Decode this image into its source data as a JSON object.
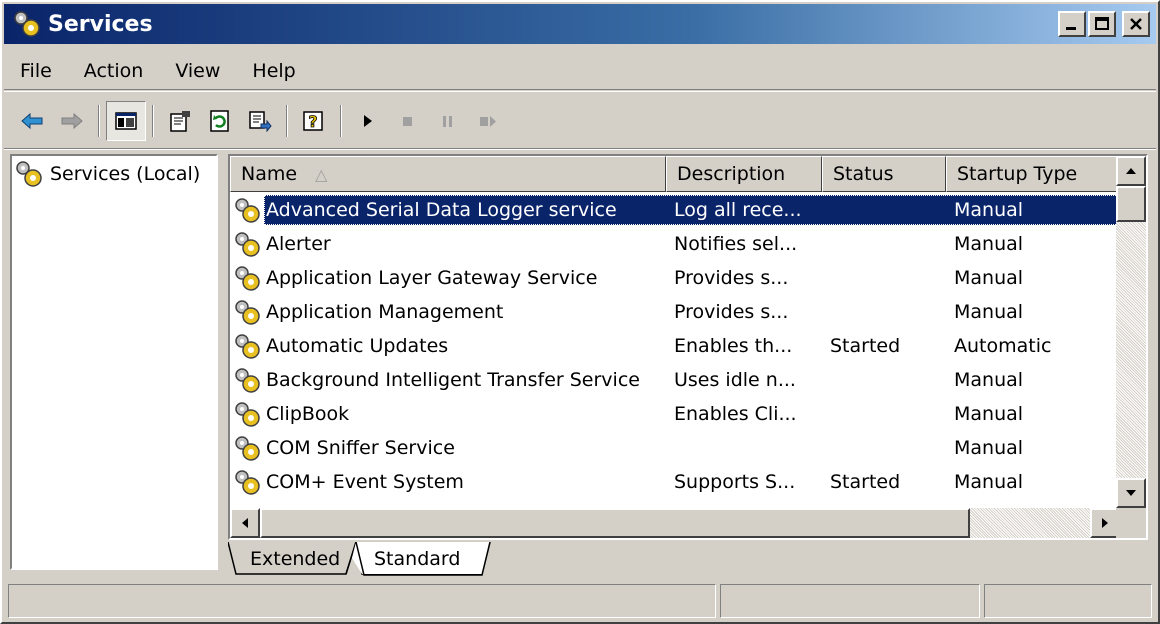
{
  "window": {
    "title": "Services"
  },
  "menu": [
    "File",
    "Action",
    "View",
    "Help"
  ],
  "toolbar": {
    "buttons": [
      "back-icon",
      "forward-icon",
      "show-hide-tree-icon",
      "properties-icon",
      "refresh-icon",
      "export-list-icon",
      "help-icon",
      "start-service-icon",
      "stop-service-icon",
      "pause-service-icon",
      "restart-service-icon"
    ]
  },
  "tree": {
    "root": "Services (Local)"
  },
  "list": {
    "columns": [
      "Name",
      "Description",
      "Status",
      "Startup Type"
    ],
    "sort_indicator": "△",
    "rows": [
      {
        "name": "Advanced Serial Data Logger service",
        "description": "Log all rece...",
        "status": "",
        "startup": "Manual",
        "selected": true
      },
      {
        "name": "Alerter",
        "description": "Notifies sel...",
        "status": "",
        "startup": "Manual"
      },
      {
        "name": "Application Layer Gateway Service",
        "description": "Provides s...",
        "status": "",
        "startup": "Manual"
      },
      {
        "name": "Application Management",
        "description": "Provides s...",
        "status": "",
        "startup": "Manual"
      },
      {
        "name": "Automatic Updates",
        "description": "Enables th...",
        "status": "Started",
        "startup": "Automatic"
      },
      {
        "name": "Background Intelligent Transfer Service",
        "description": "Uses idle n...",
        "status": "",
        "startup": "Manual"
      },
      {
        "name": "ClipBook",
        "description": "Enables Cli...",
        "status": "",
        "startup": "Manual"
      },
      {
        "name": "COM Sniffer Service",
        "description": "",
        "status": "",
        "startup": "Manual"
      },
      {
        "name": "COM+ Event System",
        "description": "Supports S...",
        "status": "Started",
        "startup": "Manual"
      }
    ]
  },
  "tabs": [
    "Extended",
    "Standard"
  ],
  "colors": {
    "selection": "#0a246a",
    "face": "#d4d0c8",
    "title_start": "#0a246a",
    "title_end": "#a6caf0"
  }
}
